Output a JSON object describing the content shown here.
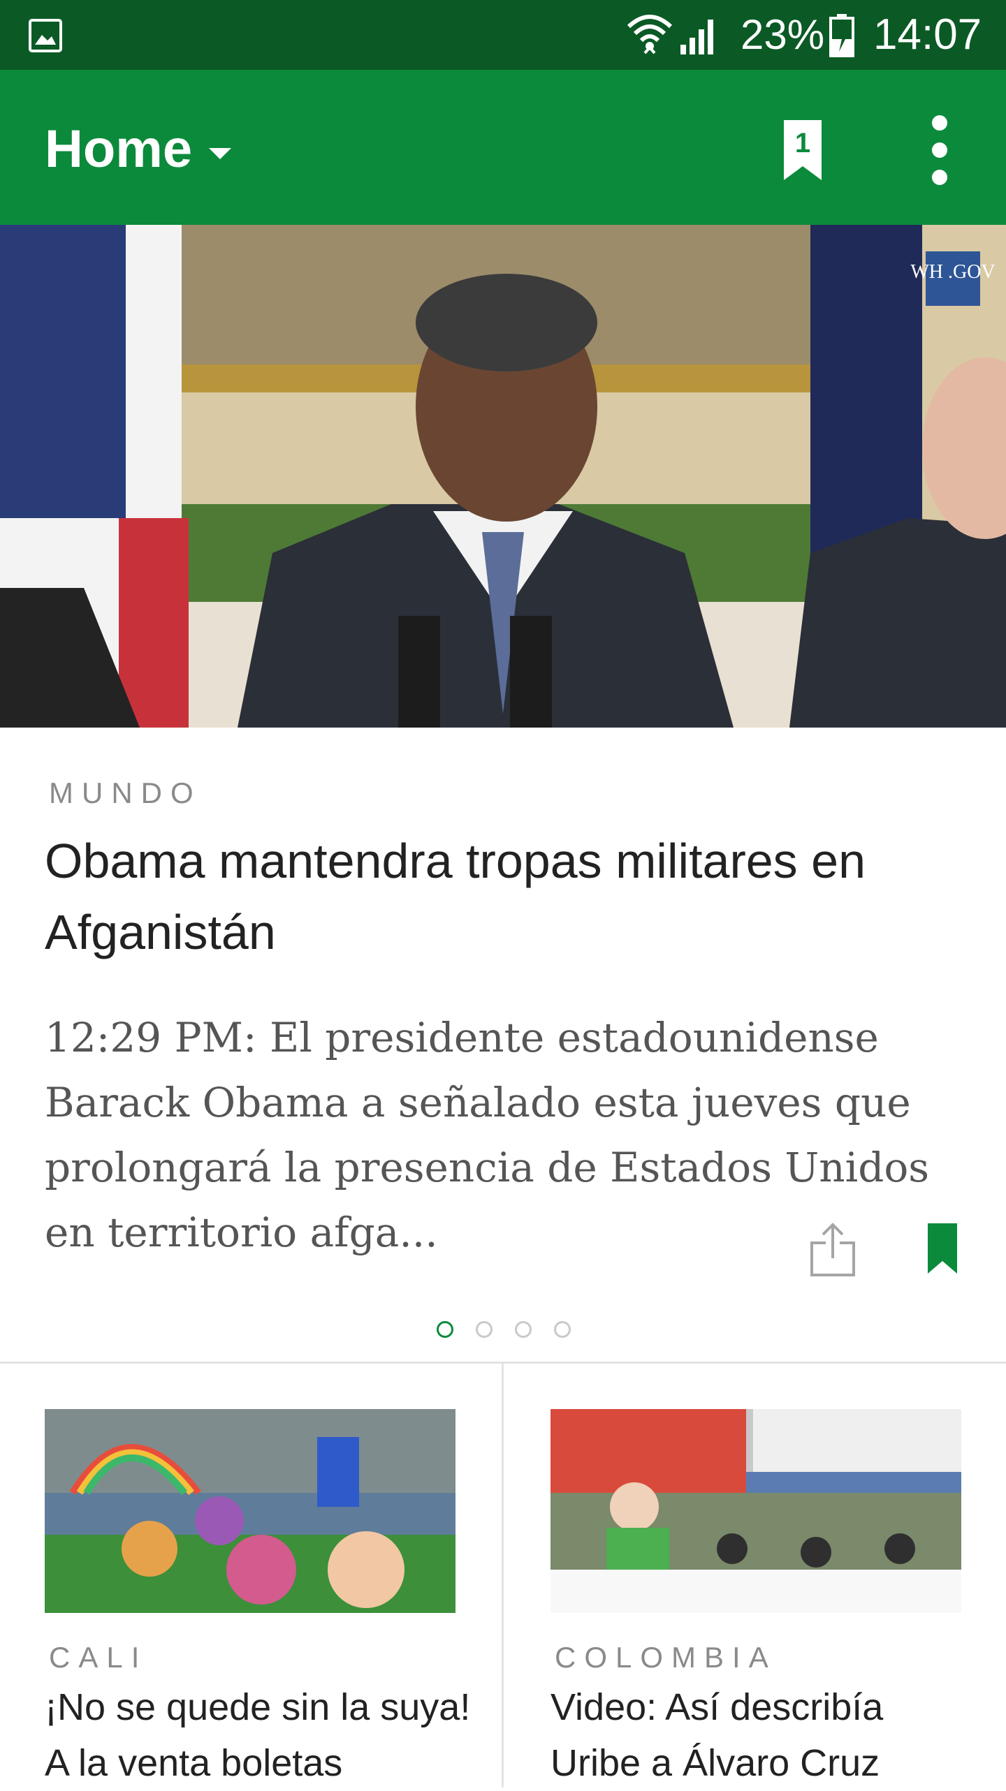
{
  "status_bar": {
    "battery": "23%",
    "time": "14:07"
  },
  "app_bar": {
    "title": "Home",
    "bookmark_count": "1"
  },
  "featured": {
    "section": "MUNDO",
    "headline": "Obama mantendra tropas militares en Afganistán",
    "summary": "12:29 PM: El presidente estadounidense Barack Obama a señalado esta jueves que prolongará la presencia de Estados Unidos en territorio afga...",
    "image_watermark": "WH .GOV",
    "pager": {
      "count": 4,
      "active": 0
    }
  },
  "cards": [
    {
      "section": "CALI",
      "title": "¡No se quede sin la suya! A la venta boletas"
    },
    {
      "section": "COLOMBIA",
      "title": "Video: Así describía Uribe a Álvaro Cruz"
    }
  ],
  "colors": {
    "status_bar": "#0b5a25",
    "app_bar": "#0c8a3c",
    "accent": "#0c8a3c"
  }
}
